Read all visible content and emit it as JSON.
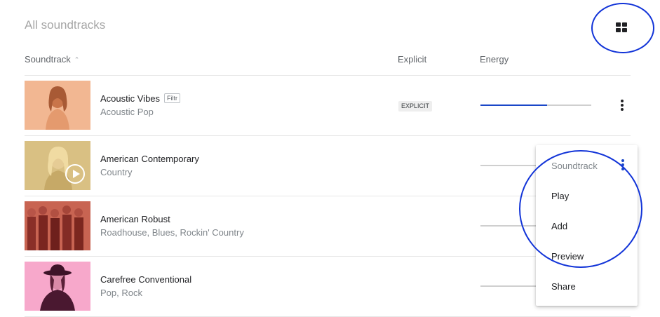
{
  "header": {
    "title": "All soundtracks",
    "view_toggle_icon": "grid-view-icon"
  },
  "columns": {
    "soundtrack": "Soundtrack",
    "sort_indicator": "^",
    "explicit": "Explicit",
    "energy": "Energy"
  },
  "rows": [
    {
      "title": "Acoustic Vibes",
      "badge": "Filtr",
      "subtitle": "Acoustic Pop",
      "explicit_label": "EXPLICIT",
      "energy": 0.6,
      "thumb_color": "#f2b792"
    },
    {
      "title": "American Contemporary",
      "subtitle": "Country",
      "energy": null,
      "thumb_color": "#d9c083"
    },
    {
      "title": "American Robust",
      "subtitle": "Roadhouse, Blues, Rockin' Country",
      "energy": null,
      "thumb_color": "#c86452"
    },
    {
      "title": "Carefree Conventional",
      "subtitle": "Pop, Rock",
      "energy": null,
      "thumb_color": "#f7a8cb"
    }
  ],
  "menu": {
    "header": "Soundtrack",
    "items": [
      "Play",
      "Add",
      "Preview",
      "Share"
    ]
  },
  "colors": {
    "accent": "#1a47c8",
    "annotation_ring": "#1234d8"
  }
}
